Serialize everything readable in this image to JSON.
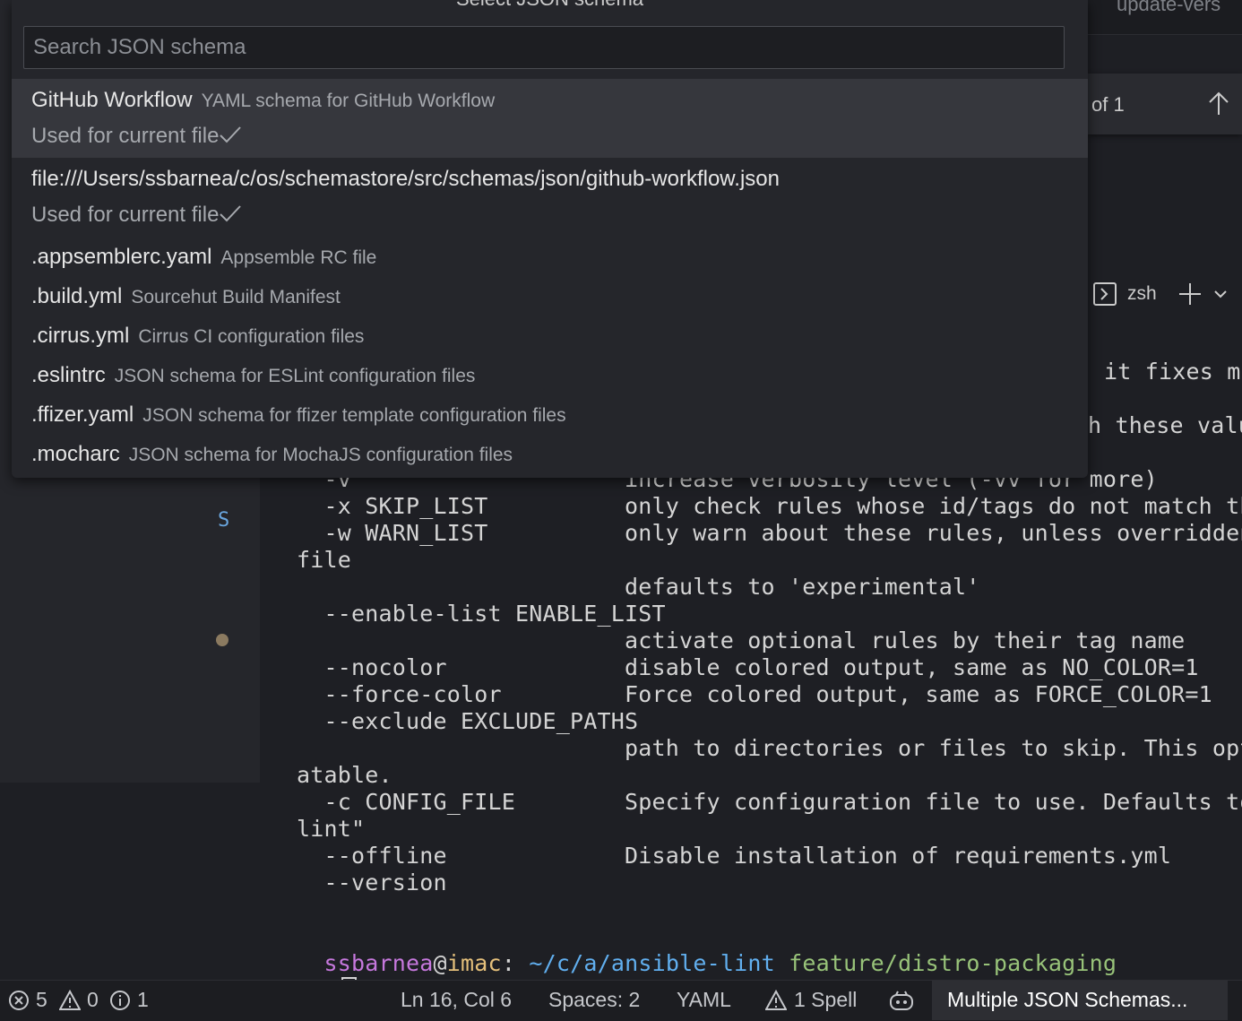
{
  "quick_pick": {
    "title": "Select JSON schema",
    "search": {
      "placeholder": "Search JSON schema",
      "value": ""
    },
    "items": [
      {
        "label": "GitHub Workflow",
        "description": "YAML schema for GitHub Workflow",
        "detail": "Used for current file"
      },
      {
        "label": "file:///Users/ssbarnea/c/os/schemastore/src/schemas/json/github-workflow.json",
        "description": "",
        "detail": "Used for current file"
      },
      {
        "label": ".appsemblerc.yaml",
        "description": "Appsemble RC file"
      },
      {
        "label": ".build.yml",
        "description": "Sourcehut Build Manifest"
      },
      {
        "label": ".cirrus.yml",
        "description": "Cirrus CI configuration files"
      },
      {
        "label": ".eslintrc",
        "description": "JSON schema for ESLint configuration files"
      },
      {
        "label": ".ffizer.yaml",
        "description": "JSON schema for ffizer template configuration files"
      },
      {
        "label": ".mocharc",
        "description": "JSON schema for MochaJS configuration files"
      }
    ]
  },
  "editor_tab": {
    "label": "update-vers"
  },
  "find_widget": {
    "count": "of 1"
  },
  "terminal_panel": {
    "shell_name": "zsh"
  },
  "sidebar": {
    "badge": "S"
  },
  "terminal": {
    "partial_top": [
      "it fixes mo",
      "h these valu"
    ],
    "lines": [
      "  -v                    increase verbosity level (-vv for more)",
      "  -x SKIP_LIST          only check rules whose id/tags do not match the",
      "  -w WARN_LIST          only warn about these rules, unless overridden",
      "file",
      "                        defaults to 'experimental'",
      "  --enable-list ENABLE_LIST",
      "                        activate optional rules by their tag name",
      "  --nocolor             disable colored output, same as NO_COLOR=1",
      "  --force-color         Force colored output, same as FORCE_COLOR=1",
      "  --exclude EXCLUDE_PATHS",
      "                        path to directories or files to skip. This opti",
      "atable.",
      "  -c CONFIG_FILE        Specify configuration file to use. Defaults to",
      "lint\"",
      "  --offline             Disable installation of requirements.yml",
      "  --version"
    ],
    "prompt": {
      "user": "ssbarnea",
      "at": "@",
      "host": "imac",
      "sep": ":",
      "path": "~/c/a/ansible-lint",
      "branch": "feature/distro-packaging",
      "symbol": "$"
    }
  },
  "status_bar": {
    "errors": "5",
    "warnings": "0",
    "infos": "1",
    "position": "Ln 16, Col 6",
    "spaces": "Spaces: 2",
    "language": "YAML",
    "spell": "1 Spell",
    "schema": "Multiple JSON Schemas..."
  },
  "colors": {
    "prompt_user": "#c678dd",
    "prompt_host": "#e5c07b",
    "prompt_path": "#61afef",
    "prompt_branch": "#98c379"
  }
}
